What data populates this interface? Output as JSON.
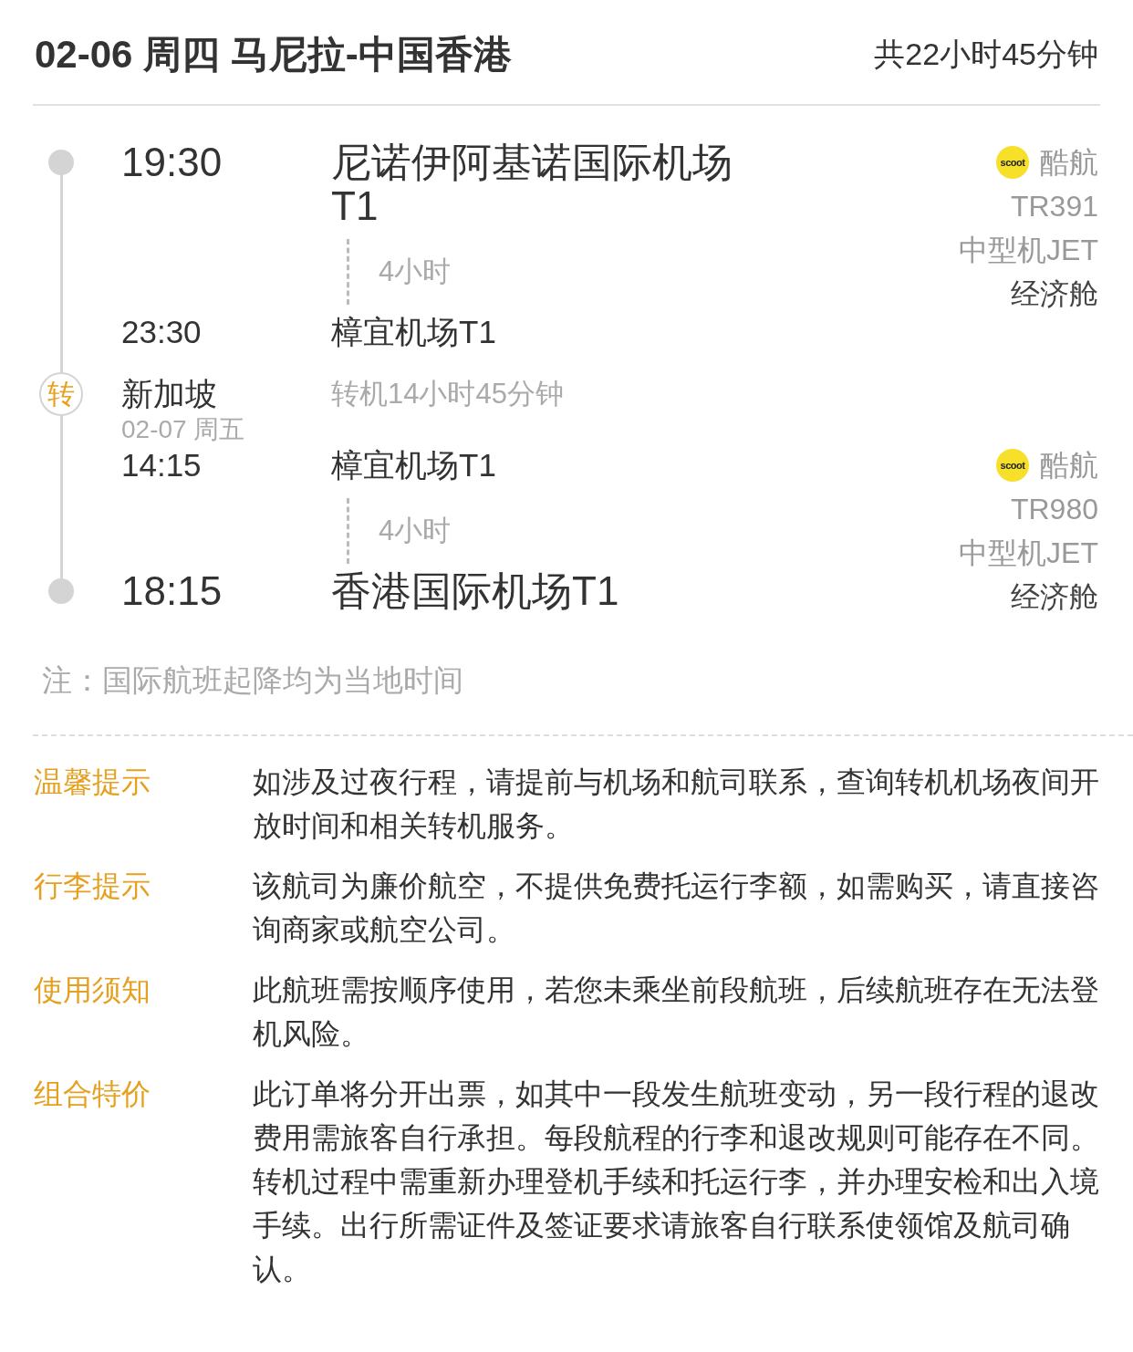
{
  "header": {
    "title": "02-06 周四 马尼拉-中国香港",
    "total_duration": "共22小时45分钟"
  },
  "itinerary": [
    {
      "kind": "flight",
      "departure": {
        "time": "19:30",
        "airport": "尼诺伊阿基诺国际机场T1"
      },
      "duration": "4小时",
      "arrival": {
        "time": "23:30",
        "airport": "樟宜机场T1"
      },
      "airline": {
        "logo": "scoot",
        "name": "酷航"
      },
      "flight_no": "TR391",
      "aircraft": "中型机JET",
      "cabin": "经济舱"
    },
    {
      "kind": "transfer",
      "badge": "转",
      "city": "新加坡",
      "duration": "转机14小时45分钟",
      "next_date": "02-07 周五"
    },
    {
      "kind": "flight",
      "departure": {
        "time": "14:15",
        "airport": "樟宜机场T1"
      },
      "duration": "4小时",
      "arrival": {
        "time": "18:15",
        "airport": "香港国际机场T1"
      },
      "airline": {
        "logo": "scoot",
        "name": "酷航"
      },
      "flight_no": "TR980",
      "aircraft": "中型机JET",
      "cabin": "经济舱"
    }
  ],
  "note": "注：国际航班起降均为当地时间",
  "tips": [
    {
      "label": "温馨提示",
      "text": "如涉及过夜行程，请提前与机场和航司联系，查询转机机场夜间开放时间和相关转机服务。"
    },
    {
      "label": "行李提示",
      "text": "该航司为廉价航空，不提供免费托运行李额，如需购买，请直接咨询商家或航空公司。"
    },
    {
      "label": "使用须知",
      "text": "此航班需按顺序使用，若您未乘坐前段航班，后续航班存在无法登机风险。"
    },
    {
      "label": "组合特价",
      "text": "此订单将分开出票，如其中一段发生航班变动，另一段行程的退改费用需旅客自行承担。每段航程的行李和退改规则可能存在不同。转机过程中需重新办理登机手续和托运行李，并办理安检和出入境手续。出行所需证件及签证要求请旅客自行联系使领馆及航司确认。"
    }
  ]
}
